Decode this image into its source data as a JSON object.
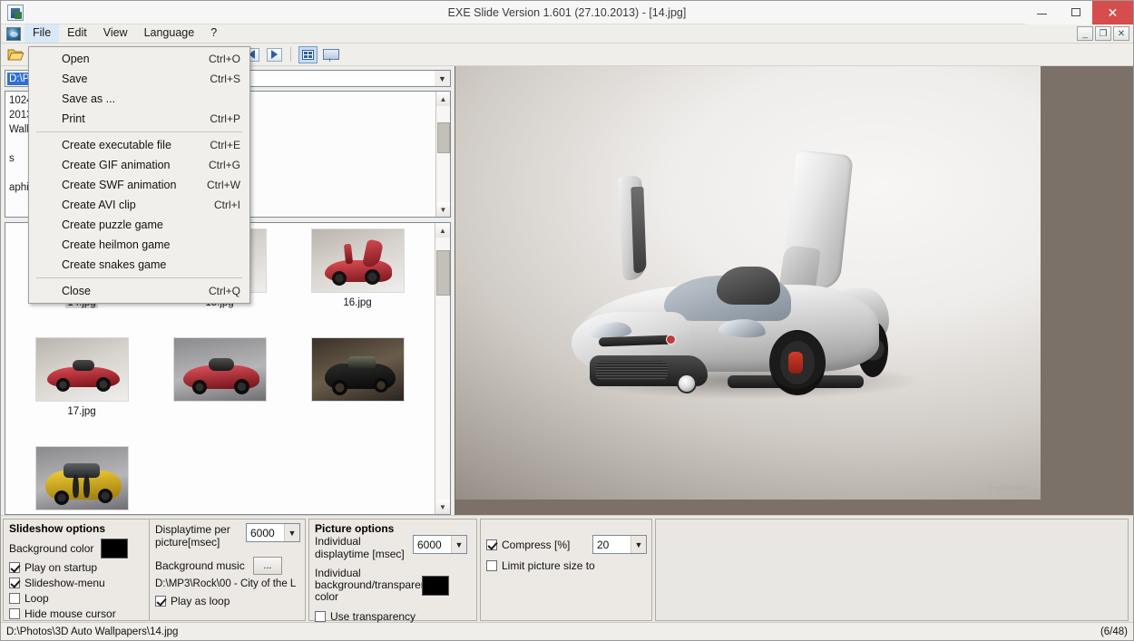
{
  "window": {
    "title": "EXE Slide Version 1.601 (27.10.2013) - [14.jpg]",
    "minimize_label": "–",
    "maximize_label": "□",
    "close_label": "✕"
  },
  "mdi_controls": {
    "minimize": "_",
    "restore": "❐",
    "close": "✕"
  },
  "menubar": {
    "items": [
      {
        "label": "File",
        "open": true
      },
      {
        "label": "Edit",
        "open": false
      },
      {
        "label": "View",
        "open": false
      },
      {
        "label": "Language",
        "open": false
      },
      {
        "label": "?",
        "open": false
      }
    ]
  },
  "file_menu": {
    "groups": [
      [
        {
          "label": "Open",
          "shortcut": "Ctrl+O"
        },
        {
          "label": "Save",
          "shortcut": "Ctrl+S"
        },
        {
          "label": "Save as ...",
          "shortcut": ""
        },
        {
          "label": "Print",
          "shortcut": "Ctrl+P"
        }
      ],
      [
        {
          "label": "Create executable file",
          "shortcut": "Ctrl+E"
        },
        {
          "label": "Create GIF animation",
          "shortcut": "Ctrl+G"
        },
        {
          "label": "Create SWF animation",
          "shortcut": "Ctrl+W"
        },
        {
          "label": "Create AVI clip",
          "shortcut": "Ctrl+I"
        },
        {
          "label": "Create puzzle game",
          "shortcut": ""
        },
        {
          "label": "Create heilmon game",
          "shortcut": ""
        },
        {
          "label": "Create snakes game",
          "shortcut": ""
        }
      ],
      [
        {
          "label": "Close",
          "shortcut": "Ctrl+Q"
        }
      ]
    ]
  },
  "toolbar": {
    "open_folder": "open-folder",
    "back": "◀",
    "forward": "▶",
    "thumbnails_view": "grid",
    "slideshow": "projector"
  },
  "path_combo": {
    "value": "D:\\P"
  },
  "file_list": {
    "rows": [
      "1024 [Set 12]",
      "2013 (TEFA)",
      "Wallpapers 1080p",
      "",
      "s",
      "",
      "aphic"
    ]
  },
  "thumbnails": [
    {
      "label": "14.jpg",
      "selected": true,
      "style": "silver-open-door"
    },
    {
      "label": "15.jpg",
      "selected": false,
      "style": "red-rear"
    },
    {
      "label": "16.jpg",
      "selected": false,
      "style": "red-door-up"
    },
    {
      "label": "17.jpg",
      "selected": false,
      "style": "red-roadster"
    },
    {
      "label": "",
      "selected": false,
      "style": "red-roadster-2"
    },
    {
      "label": "",
      "selected": false,
      "style": "black-muscle"
    },
    {
      "label": "",
      "selected": false,
      "style": "yellow-muscle"
    }
  ],
  "preview": {
    "watermark": "© wallpapers"
  },
  "slideshow_options": {
    "title": "Slideshow options",
    "background_color_label": "Background color",
    "background_color": "#000000",
    "play_on_startup": {
      "label": "Play on startup",
      "checked": true
    },
    "slideshow_menu": {
      "label": "Slideshow-menu",
      "checked": true
    },
    "loop": {
      "label": "Loop",
      "checked": false
    },
    "hide_mouse": {
      "label": "Hide mouse cursor",
      "checked": false
    },
    "displaytime_label": "Displaytime per picture[msec]",
    "displaytime_value": "6000",
    "background_music_label": "Background music",
    "background_music_button": "...",
    "background_music_path": "D:\\MP3\\Rock\\00 - City of the L",
    "play_as_loop": {
      "label": "Play as loop",
      "checked": true
    }
  },
  "picture_options": {
    "title": "Picture options",
    "individual_displaytime_label": "Individual displaytime [msec]",
    "individual_displaytime_value": "6000",
    "individual_bg_label": "Individual background/transparent color",
    "individual_bg_color": "#000000",
    "use_transparency": {
      "label": "Use transparency",
      "checked": false
    },
    "compress": {
      "label": "Compress [%]",
      "checked": true,
      "value": "20"
    },
    "limit_size": {
      "label": "Limit picture size to",
      "checked": false
    }
  },
  "statusbar": {
    "path": "D:\\Photos\\3D Auto Wallpapers\\14.jpg",
    "count": "(6/48)"
  }
}
